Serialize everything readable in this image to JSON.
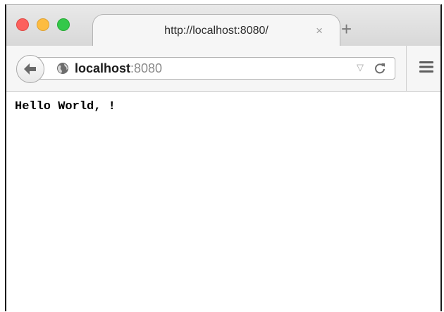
{
  "window": {
    "controls": {
      "close_color": "#fc615d",
      "minimize_color": "#fdbc40",
      "zoom_color": "#34c84a"
    }
  },
  "tab": {
    "title": "http://localhost:8080/",
    "close_glyph": "×",
    "new_tab_glyph": "+"
  },
  "navbar": {
    "back_icon": "back-arrow-icon",
    "site_icon": "globe-icon",
    "url_host": "localhost",
    "url_port": ":8080",
    "dropmarker_glyph": "▽",
    "reload_icon": "reload-icon",
    "menu_icon": "hamburger-menu-icon"
  },
  "page": {
    "text": "Hello World, !"
  }
}
